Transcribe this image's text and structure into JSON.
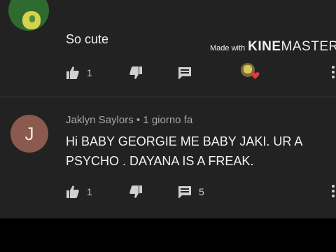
{
  "comment1": {
    "text": "So cute",
    "likes": "1",
    "icons": [
      "thumbs-up-icon",
      "thumbs-down-icon",
      "reply-icon",
      "creator-heart-icon",
      "more-vert-icon"
    ]
  },
  "watermark": {
    "prefix": "Made with",
    "brand_bold": "KINE",
    "brand_light": "MASTER"
  },
  "comment2": {
    "author": "Jaklyn Saylors",
    "separator": "•",
    "time": "1 giorno fa",
    "avatar_letter": "J",
    "text": "Hi BABY GEORGIE ME BABY JAKI. UR A PSYCHO . DAYANA IS A FREAK.",
    "likes": "1",
    "replies": "5",
    "avatar_color": "#8a5a4e"
  },
  "colors": {
    "background": "#222222",
    "text": "#f2f2f2",
    "meta": "#a8a8a8"
  }
}
